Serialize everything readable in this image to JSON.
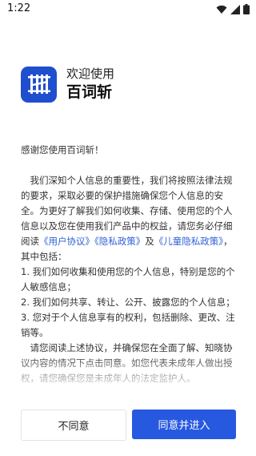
{
  "status": {
    "time": "1:22"
  },
  "header": {
    "welcome": "欢迎使用",
    "app_name": "百词斩"
  },
  "content": {
    "greeting": "感谢您使用百词斩！",
    "intro_1": "我们深知个人信息的重要性，我们将按照法律法规的要求，采取必要的保护措施确保您个人信息的安全。为更好了解我们如何收集、存储、使用您的个人信息以及您在使用我们产品中的权益，请您务必仔细阅读",
    "link_user": "《用户协议》",
    "link_privacy": "《隐私政策》",
    "and": "及",
    "link_children": "《儿童隐私政策》",
    "intro_2": "，其中包括：",
    "item_1": "1. 我们如何收集和使用您的个人信息，特别是您的个人敏感信息；",
    "item_2": "2. 我们如何共享、转让、公开、披露您的个人信息；",
    "item_3": "3. 您对于个人信息享有的权利，包括删除、更改、注销等。",
    "outro": "请您阅读上述协议，并确保您在全面了解、知晓协议内容的情况下点击同意。如您代表未成年人做出授权，请您确保您是未成年人的法定监护人。"
  },
  "buttons": {
    "decline": "不同意",
    "accept": "同意并进入"
  },
  "colors": {
    "brand": "#1f4fcf",
    "accent_button": "#2758e0",
    "link": "#2f5fd8"
  }
}
